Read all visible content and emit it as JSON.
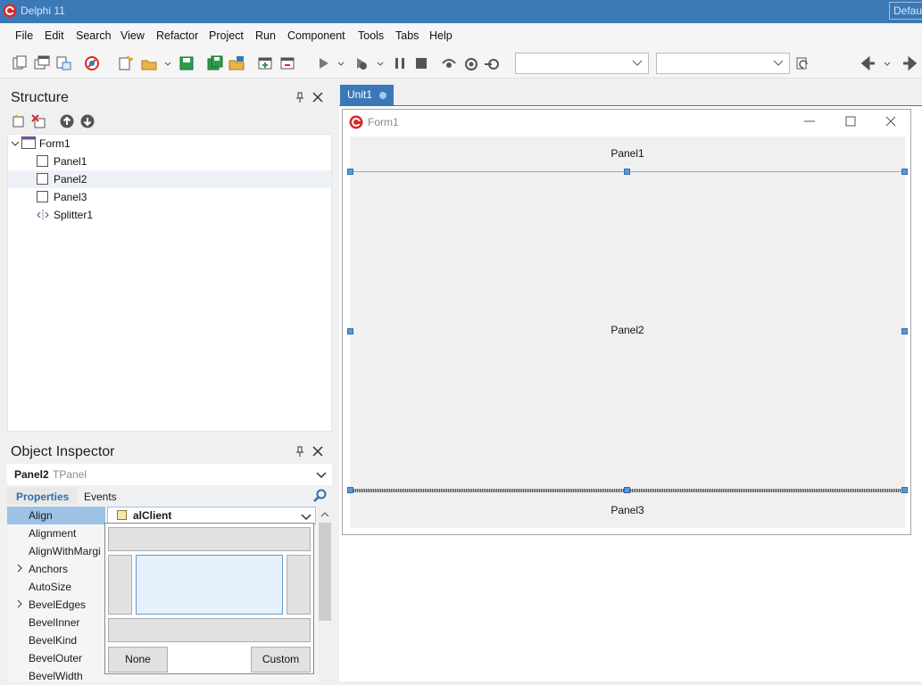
{
  "window": {
    "title": "Delphi 11",
    "layout_name": "Defau"
  },
  "menu": [
    "File",
    "Edit",
    "Search",
    "View",
    "Refactor",
    "Project",
    "Run",
    "Component",
    "Tools",
    "Tabs",
    "Help"
  ],
  "toolbar": {
    "icons": [
      "new-items-icon",
      "new-form-icon",
      "new-unit-icon",
      "remove-icon",
      "new-icon",
      "open-icon",
      "save-icon",
      "save-all-icon",
      "open-project-icon",
      "add-to-project-icon",
      "remove-from-project-icon",
      "run-icon",
      "run-without-debug-icon",
      "pause-icon",
      "stop-icon",
      "step-over-icon",
      "trace-into-icon",
      "run-to-cursor-icon",
      "refresh-icon",
      "back-icon",
      "forward-icon"
    ],
    "combo1_value": "",
    "combo2_value": ""
  },
  "structure": {
    "title": "Structure",
    "tree": [
      {
        "label": "Form1",
        "level": 0,
        "kind": "form",
        "expanded": true
      },
      {
        "label": "Panel1",
        "level": 1,
        "kind": "panel"
      },
      {
        "label": "Panel2",
        "level": 1,
        "kind": "panel",
        "selected": true
      },
      {
        "label": "Panel3",
        "level": 1,
        "kind": "panel"
      },
      {
        "label": "Splitter1",
        "level": 1,
        "kind": "splitter"
      }
    ]
  },
  "inspector": {
    "title": "Object Inspector",
    "object_name": "Panel2",
    "object_type": "TPanel",
    "tabs": {
      "properties": "Properties",
      "events": "Events"
    },
    "properties": [
      {
        "name": "Align",
        "expandable": false,
        "selected": true
      },
      {
        "name": "Alignment",
        "expandable": false
      },
      {
        "name": "AlignWithMargi",
        "expandable": false
      },
      {
        "name": "Anchors",
        "expandable": true
      },
      {
        "name": "AutoSize",
        "expandable": false
      },
      {
        "name": "BevelEdges",
        "expandable": true
      },
      {
        "name": "BevelInner",
        "expandable": false
      },
      {
        "name": "BevelKind",
        "expandable": false
      },
      {
        "name": "BevelOuter",
        "expandable": false
      },
      {
        "name": "BevelWidth",
        "expandable": false
      }
    ],
    "align_value": "alClient",
    "align_popup": {
      "none_label": "None",
      "custom_label": "Custom"
    }
  },
  "designer": {
    "tab_label": "Unit1",
    "form_title": "Form1",
    "panels": {
      "top": "Panel1",
      "client": "Panel2",
      "bottom": "Panel3"
    }
  },
  "colors": {
    "accent": "#3b79b6",
    "selection": "#9cc3e6",
    "handle": "#5b9bd5"
  }
}
